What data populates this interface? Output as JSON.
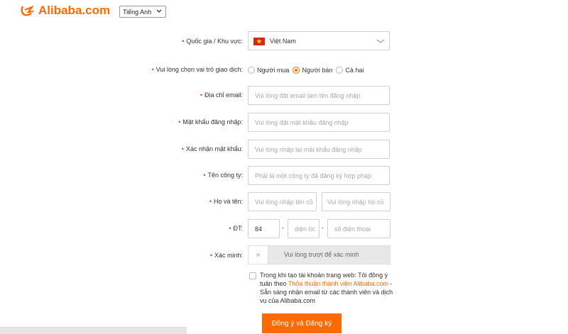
{
  "header": {
    "logo_text": "Alibaba.com",
    "language": "Tiếng Anh"
  },
  "form": {
    "country": {
      "label": "Quốc gia / Khu vực:",
      "value": "Việt Nam"
    },
    "role": {
      "label": "Vui lòng chọn vai trò giao dịch:",
      "options": [
        "Người mua",
        "Người bán",
        "Cả hai"
      ],
      "selected": "Người bán"
    },
    "email": {
      "label": "Địa chỉ email:",
      "placeholder": "Vui lòng đặt email làm tên đăng nhập"
    },
    "password": {
      "label": "Mật khẩu đăng nhập:",
      "placeholder": "Vui lòng đặt mật khẩu đăng nhập"
    },
    "confirm_password": {
      "label": "Xác nhận mật khẩu:",
      "placeholder": "Vui lòng nhập lại mật khẩu đăng nhập"
    },
    "company": {
      "label": "Tên công ty:",
      "placeholder": "Phải là một công ty đã đăng ký hợp pháp"
    },
    "name": {
      "label": "Họ và tên:",
      "first_placeholder": "Vui lòng nhập tên củ",
      "last_placeholder": "Vui lòng nhập họ củ"
    },
    "phone": {
      "label": "ĐT:",
      "country_code": "84",
      "area_placeholder": "diện tíc",
      "number_placeholder": "số điện thoại",
      "separator": "-"
    },
    "verify": {
      "label": "Xác minh:",
      "handle": "»",
      "text": "Vui lòng trượt để xác minh"
    },
    "terms": {
      "text_before": "Trong khi tạo tài khoản trang web: Tôi đồng ý tuân theo ",
      "link": "Thỏa thuận thành viên Alibaba.com",
      "text_after": " - Sẵn sàng nhận email từ các thành viên và dịch vụ của Alibaba.com"
    },
    "submit": "Đồng ý và Đăng ký"
  },
  "colors": {
    "accent": "#ff6a00",
    "required": "#e4393c"
  }
}
